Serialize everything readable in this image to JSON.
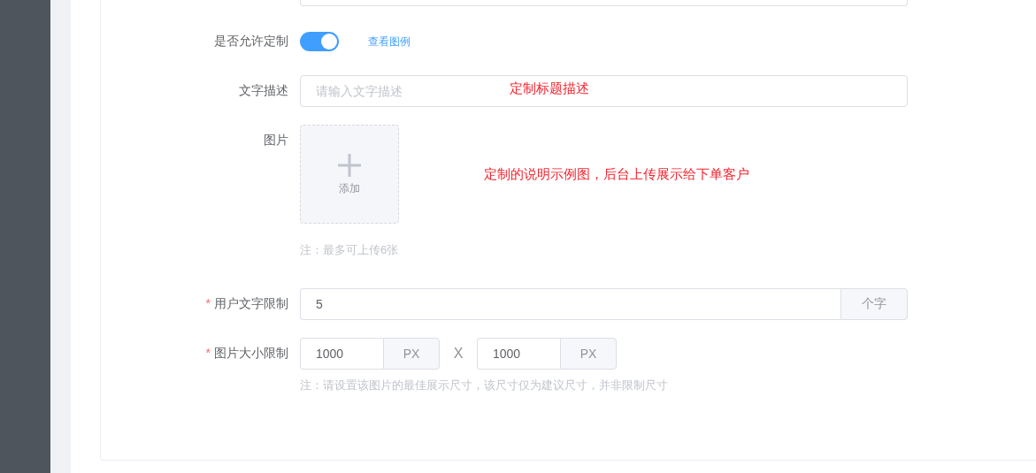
{
  "required_mark": "*",
  "allow_custom": {
    "label": "是否允许定制",
    "on": true,
    "link": "查看图例"
  },
  "description": {
    "label": "文字描述",
    "placeholder": "请输入文字描述",
    "annotation": "定制标题描述"
  },
  "images": {
    "label": "图片",
    "upload_label": "添加",
    "annotation": "定制的说明示例图，后台上传展示给下单客户",
    "note": "注：最多可上传6张"
  },
  "text_limit": {
    "label": "用户文字限制",
    "required": true,
    "value": "5",
    "unit": "个字"
  },
  "size_limit": {
    "label": "图片大小限制",
    "required": true,
    "width": {
      "value": "1000",
      "unit": "PX"
    },
    "separator": "X",
    "height": {
      "value": "1000",
      "unit": "PX"
    },
    "note": "注：请设置该图片的最佳展示尺寸，该尺寸仅为建议尺寸，并非限制尺寸"
  }
}
